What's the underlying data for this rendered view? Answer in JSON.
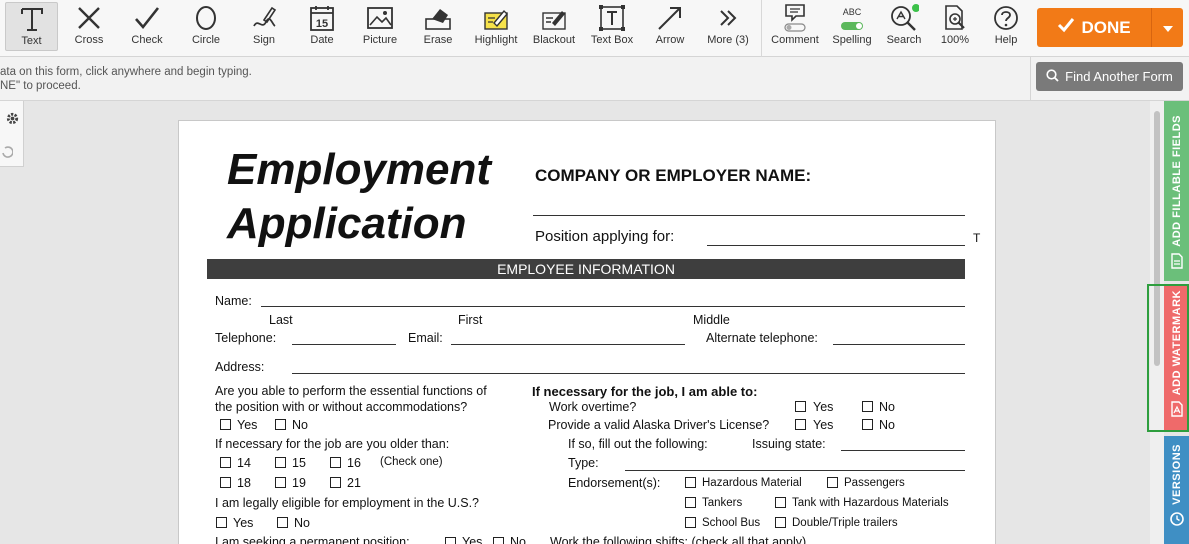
{
  "toolbar": {
    "tools": [
      {
        "label": "Text",
        "icon": "text-icon"
      },
      {
        "label": "Cross",
        "icon": "cross-icon"
      },
      {
        "label": "Check",
        "icon": "check-icon"
      },
      {
        "label": "Circle",
        "icon": "circle-icon"
      },
      {
        "label": "Sign",
        "icon": "sign-icon"
      },
      {
        "label": "Date",
        "icon": "date-icon",
        "day": "15"
      },
      {
        "label": "Picture",
        "icon": "picture-icon"
      },
      {
        "label": "Erase",
        "icon": "erase-icon"
      },
      {
        "label": "Highlight",
        "icon": "highlight-icon"
      },
      {
        "label": "Blackout",
        "icon": "blackout-icon"
      },
      {
        "label": "Text Box",
        "icon": "textbox-icon"
      },
      {
        "label": "Arrow",
        "icon": "arrow-icon"
      },
      {
        "label": "More (3)",
        "icon": "more-icon"
      }
    ],
    "right_tools": [
      {
        "label": "Comment",
        "icon": "comment-icon"
      },
      {
        "label": "Spelling",
        "icon": "spelling-icon",
        "badge": "ABC"
      },
      {
        "label": "Search",
        "icon": "search-icon"
      },
      {
        "label": "100%",
        "icon": "zoom-icon"
      },
      {
        "label": "Help",
        "icon": "help-icon"
      }
    ],
    "done_label": "DONE",
    "accent_color": "#f27a17"
  },
  "infobar": {
    "line1": "ata on this form, click anywhere and begin typing.",
    "line2": "NE\" to proceed.",
    "find_label": "Find Another Form"
  },
  "sidetabs": {
    "fillable": "ADD FILLABLE FIELDS",
    "watermark": "ADD WATERMARK",
    "versions": "VERSIONS",
    "colors": {
      "fillable": "#6bbf7a",
      "watermark": "#ef6a6a",
      "versions": "#3f8fc4"
    }
  },
  "form": {
    "title_line1": "Employment",
    "title_line2": "Application",
    "company_label": "COMPANY OR EMPLOYER NAME:",
    "position_label": "Position applying for:",
    "t_letter": "T",
    "section": "EMPLOYEE INFORMATION",
    "name_label": "Name:",
    "last": "Last",
    "first": "First",
    "middle": "Middle",
    "telephone": "Telephone:",
    "email": "Email:",
    "alt_phone": "Alternate telephone:",
    "address": "Address:",
    "q1_line1": "Are you able to perform the essential functions of",
    "q1_line2": "the position with or without accommodations?",
    "yes": "Yes",
    "no": "No",
    "older_label": "If necessary for the job are you older than:",
    "ages": [
      "14",
      "15",
      "16",
      "18",
      "19",
      "21"
    ],
    "check_one": "(Check one)",
    "eligible": "I am legally eligible for employment in the U.S.?",
    "permanent": "I am seeking a permanent position:",
    "able_header": "If necessary for the job, I am able to:",
    "overtime": "Work overtime?",
    "license": "Provide a valid Alaska Driver's License?",
    "fill_following": "If so, fill out the following:",
    "issuing": "Issuing state:",
    "type": "Type:",
    "endorsements": "Endorsement(s):",
    "endorse_items": [
      "Hazardous Material",
      "Passengers",
      "Tankers",
      "Tank with Hazardous Materials",
      "School Bus",
      "Double/Triple trailers"
    ],
    "shifts": "Work the following shifts: (check all that apply)"
  }
}
